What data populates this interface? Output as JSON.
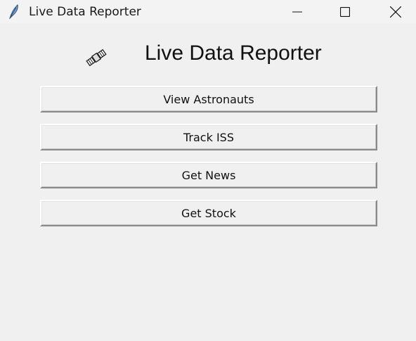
{
  "window": {
    "title": "Live Data Reporter",
    "controls": {
      "minimize": "minimize-icon",
      "maximize": "maximize-icon",
      "close": "close-icon"
    }
  },
  "header": {
    "icon": "satellite-icon",
    "title": "Live Data Reporter"
  },
  "buttons": {
    "view_astronauts": "View Astronauts",
    "track_iss": "Track ISS",
    "get_news": "Get News",
    "get_stock": "Get Stock"
  },
  "colors": {
    "background": "#f0f0f0",
    "titlebar": "#f3f3f3",
    "text": "#111111"
  }
}
